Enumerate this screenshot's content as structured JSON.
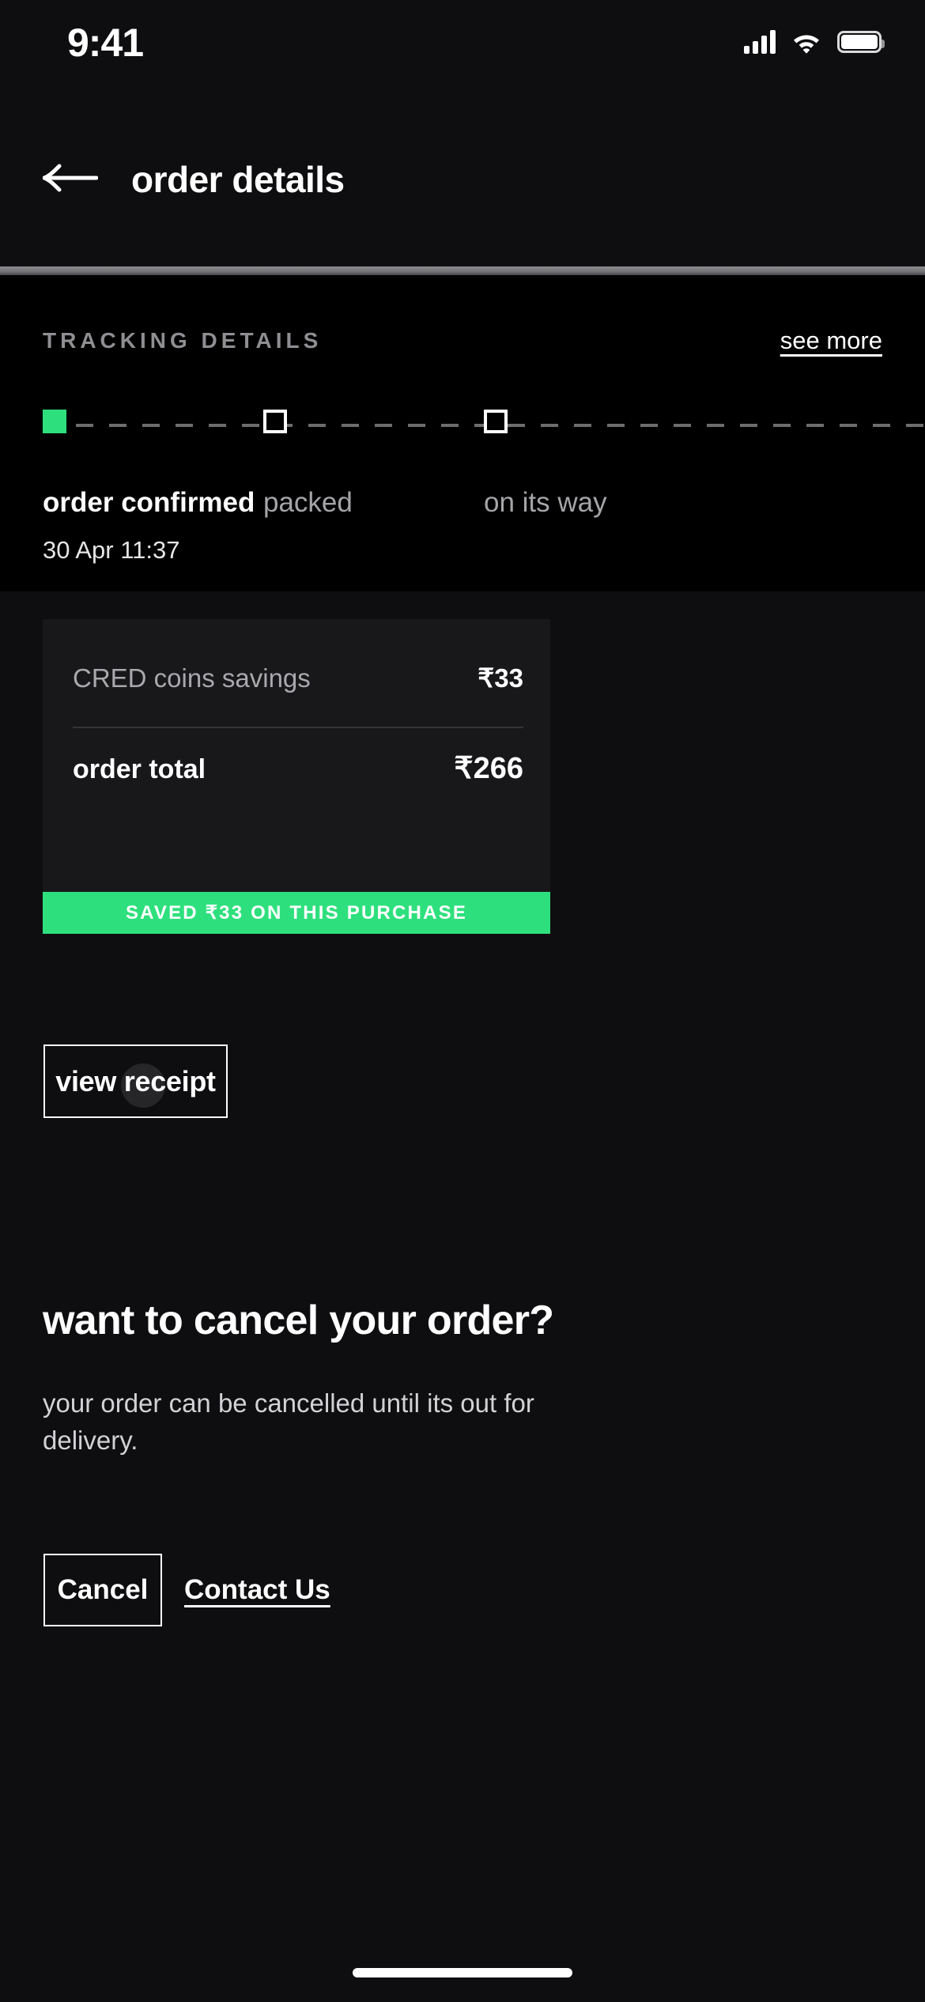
{
  "status_bar": {
    "time": "9:41",
    "signal_icon": "cellular-signal-icon",
    "wifi_icon": "wifi-icon",
    "battery_icon": "battery-icon"
  },
  "header": {
    "back_icon": "back-arrow-icon",
    "title": "order details"
  },
  "tracking": {
    "section_label": "TRACKING DETAILS",
    "see_more_label": "see more",
    "steps": [
      {
        "label": "order confirmed",
        "state": "done",
        "timestamp": "30 Apr 11:37"
      },
      {
        "label": "packed",
        "state": "pending",
        "timestamp": ""
      },
      {
        "label": "on its way",
        "state": "pending",
        "timestamp": ""
      }
    ]
  },
  "summary": {
    "savings_label": "CRED coins savings",
    "savings_value": "₹33",
    "total_label": "order total",
    "total_value": "₹266",
    "saved_banner": "SAVED ₹33 ON THIS PURCHASE"
  },
  "actions": {
    "view_receipt_label": "view receipt"
  },
  "cancel_section": {
    "heading": "want to cancel your order?",
    "description": "your order can be cancelled until its out for delivery.",
    "cancel_button_label": "Cancel",
    "contact_link_label": "Contact Us"
  },
  "colors": {
    "accent_green": "#2ee07d",
    "background": "#0e0e10",
    "panel_black": "#000000",
    "card": "#18181b",
    "muted_text": "#a9a9ad"
  }
}
